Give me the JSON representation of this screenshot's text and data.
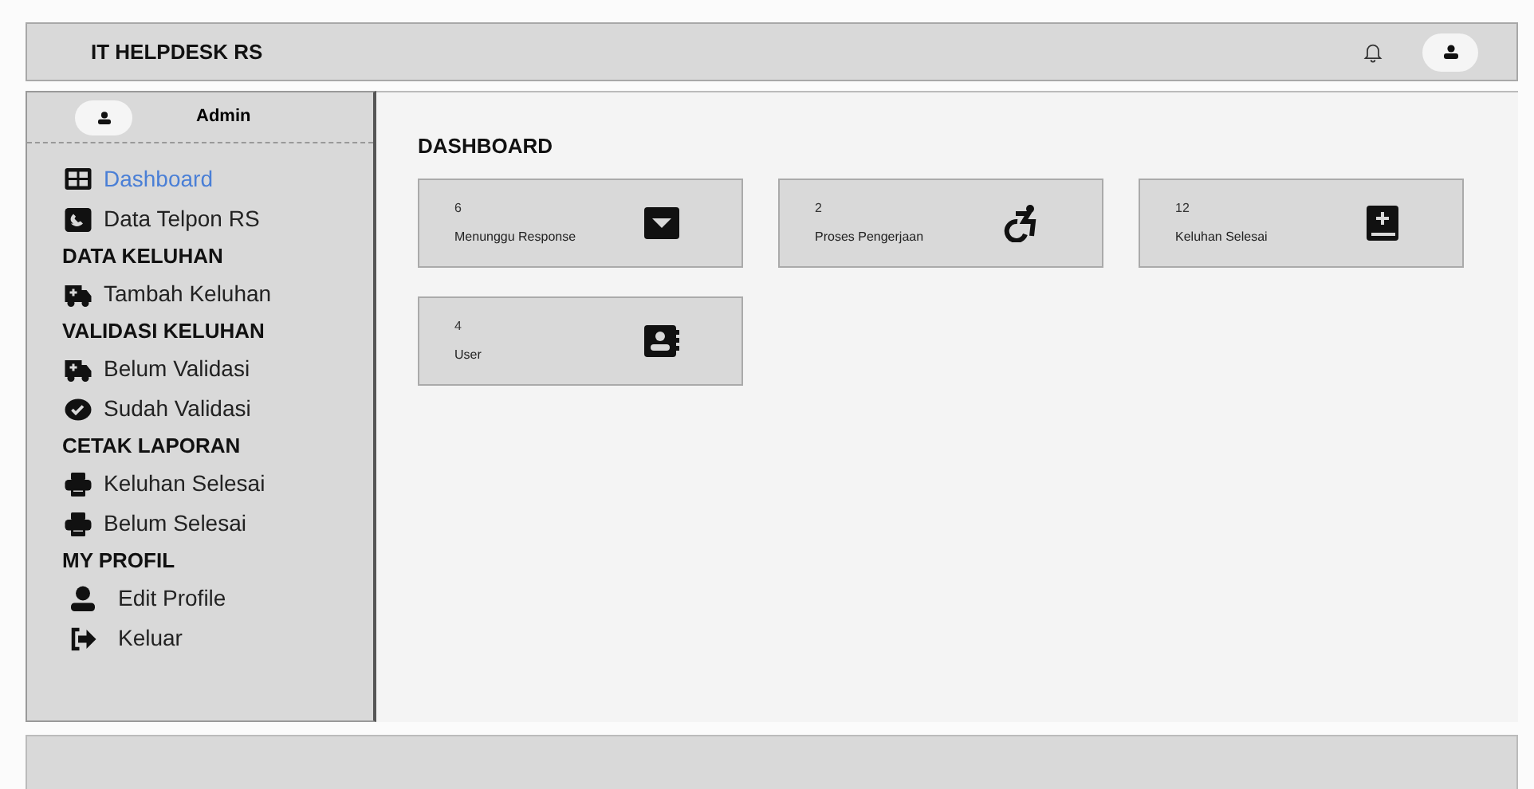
{
  "header": {
    "title": "IT HELPDESK RS"
  },
  "sidebar": {
    "user": "Admin",
    "items": [
      {
        "kind": "link",
        "label": "Dashboard",
        "selected": true
      },
      {
        "kind": "link",
        "label": "Data Telpon RS",
        "selected": false
      },
      {
        "kind": "heading",
        "label": "DATA KELUHAN"
      },
      {
        "kind": "link",
        "label": "Tambah Keluhan",
        "selected": false
      },
      {
        "kind": "heading",
        "label": "VALIDASI KELUHAN"
      },
      {
        "kind": "link",
        "label": "Belum Validasi",
        "selected": false
      },
      {
        "kind": "link",
        "label": "Sudah Validasi",
        "selected": false
      },
      {
        "kind": "heading",
        "label": "CETAK LAPORAN"
      },
      {
        "kind": "link",
        "label": "Keluhan Selesai",
        "selected": false
      },
      {
        "kind": "link",
        "label": "Belum Selesai",
        "selected": false
      },
      {
        "kind": "heading",
        "label": "MY PROFIL"
      },
      {
        "kind": "link",
        "label": "Edit Profile",
        "selected": false
      },
      {
        "kind": "link",
        "label": "Keluar",
        "selected": false
      }
    ]
  },
  "main": {
    "title": "DASHBOARD",
    "cards": [
      {
        "count": "6",
        "label": "Menunggu Response"
      },
      {
        "count": "2",
        "label": "Proses Pengerjaan"
      },
      {
        "count": "12",
        "label": "Keluhan Selesai"
      },
      {
        "count": "4",
        "label": "User"
      }
    ]
  }
}
